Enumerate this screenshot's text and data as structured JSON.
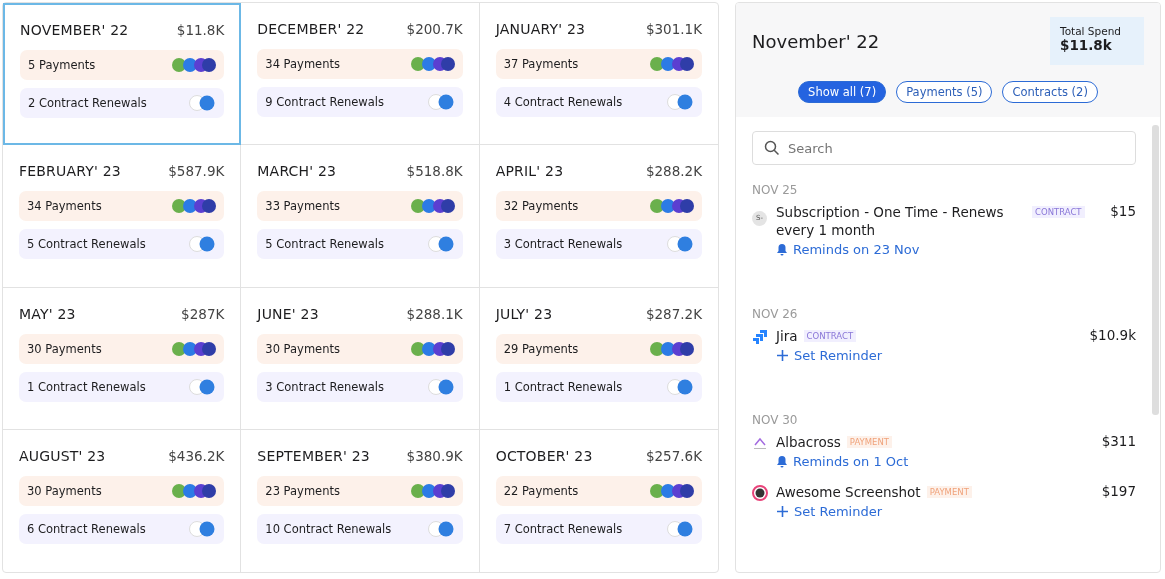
{
  "months": [
    {
      "title": "NOVEMBER' 22",
      "total": "$11.8K",
      "selected": true,
      "payments": "5 Payments",
      "renewals": "2 Contract Renewals"
    },
    {
      "title": "DECEMBER' 22",
      "total": "$200.7K",
      "selected": false,
      "payments": "34 Payments",
      "renewals": "9 Contract Renewals"
    },
    {
      "title": "JANUARY' 23",
      "total": "$301.1K",
      "selected": false,
      "payments": "37 Payments",
      "renewals": "4 Contract Renewals"
    },
    {
      "title": "FEBRUARY' 23",
      "total": "$587.9K",
      "selected": false,
      "payments": "34 Payments",
      "renewals": "5 Contract Renewals"
    },
    {
      "title": "MARCH' 23",
      "total": "$518.8K",
      "selected": false,
      "payments": "33 Payments",
      "renewals": "5 Contract Renewals"
    },
    {
      "title": "APRIL' 23",
      "total": "$288.2K",
      "selected": false,
      "payments": "32 Payments",
      "renewals": "3 Contract Renewals"
    },
    {
      "title": "MAY' 23",
      "total": "$287K",
      "selected": false,
      "payments": "30 Payments",
      "renewals": "1 Contract Renewals"
    },
    {
      "title": "JUNE' 23",
      "total": "$288.1K",
      "selected": false,
      "payments": "30 Payments",
      "renewals": "3 Contract Renewals"
    },
    {
      "title": "JULY' 23",
      "total": "$287.2K",
      "selected": false,
      "payments": "29 Payments",
      "renewals": "1 Contract Renewals"
    },
    {
      "title": "AUGUST' 23",
      "total": "$436.2K",
      "selected": false,
      "payments": "30 Payments",
      "renewals": "6 Contract Renewals"
    },
    {
      "title": "SEPTEMBER' 23",
      "total": "$380.9K",
      "selected": false,
      "payments": "23 Payments",
      "renewals": "10 Contract Renewals"
    },
    {
      "title": "OCTOBER' 23",
      "total": "$257.6K",
      "selected": false,
      "payments": "22 Payments",
      "renewals": "7 Contract Renewals"
    }
  ],
  "panel": {
    "title": "November' 22",
    "total_label": "Total Spend",
    "total_value": "$11.8k",
    "filters": [
      {
        "label": "Show all (7)",
        "selected": true
      },
      {
        "label": "Payments (5)",
        "selected": false
      },
      {
        "label": "Contracts (2)",
        "selected": false
      }
    ],
    "search": {
      "placeholder": "Search"
    },
    "groups": [
      {
        "date": "NOV 25",
        "items": [
          {
            "kind": "avatar",
            "avatar_text": "S-",
            "name": "Subscription - One Time - Renews every 1 month",
            "tag": {
              "text": "CONTRACT",
              "kind": "contract"
            },
            "amount": "$15",
            "action": {
              "text": "Reminds on 23 Nov",
              "kind": "reminder"
            }
          }
        ]
      },
      {
        "date": "NOV 26",
        "items": [
          {
            "kind": "chevrons",
            "name": "Jira",
            "tag": {
              "text": "CONTRACT",
              "kind": "contract"
            },
            "amount": "$10.9k",
            "action": {
              "text": "Set Reminder",
              "kind": "set"
            }
          }
        ]
      },
      {
        "date": "NOV 30",
        "items": [
          {
            "kind": "caret",
            "name": "Albacross",
            "tag": {
              "text": "PAYMENT",
              "kind": "payment"
            },
            "amount": "$311",
            "action": {
              "text": "Reminds on 1 Oct",
              "kind": "reminder"
            }
          },
          {
            "kind": "lens",
            "name": "Awesome Screenshot",
            "tag": {
              "text": "PAYMENT",
              "kind": "payment"
            },
            "amount": "$197",
            "action": {
              "text": "Set Reminder",
              "kind": "set"
            }
          }
        ]
      }
    ]
  }
}
